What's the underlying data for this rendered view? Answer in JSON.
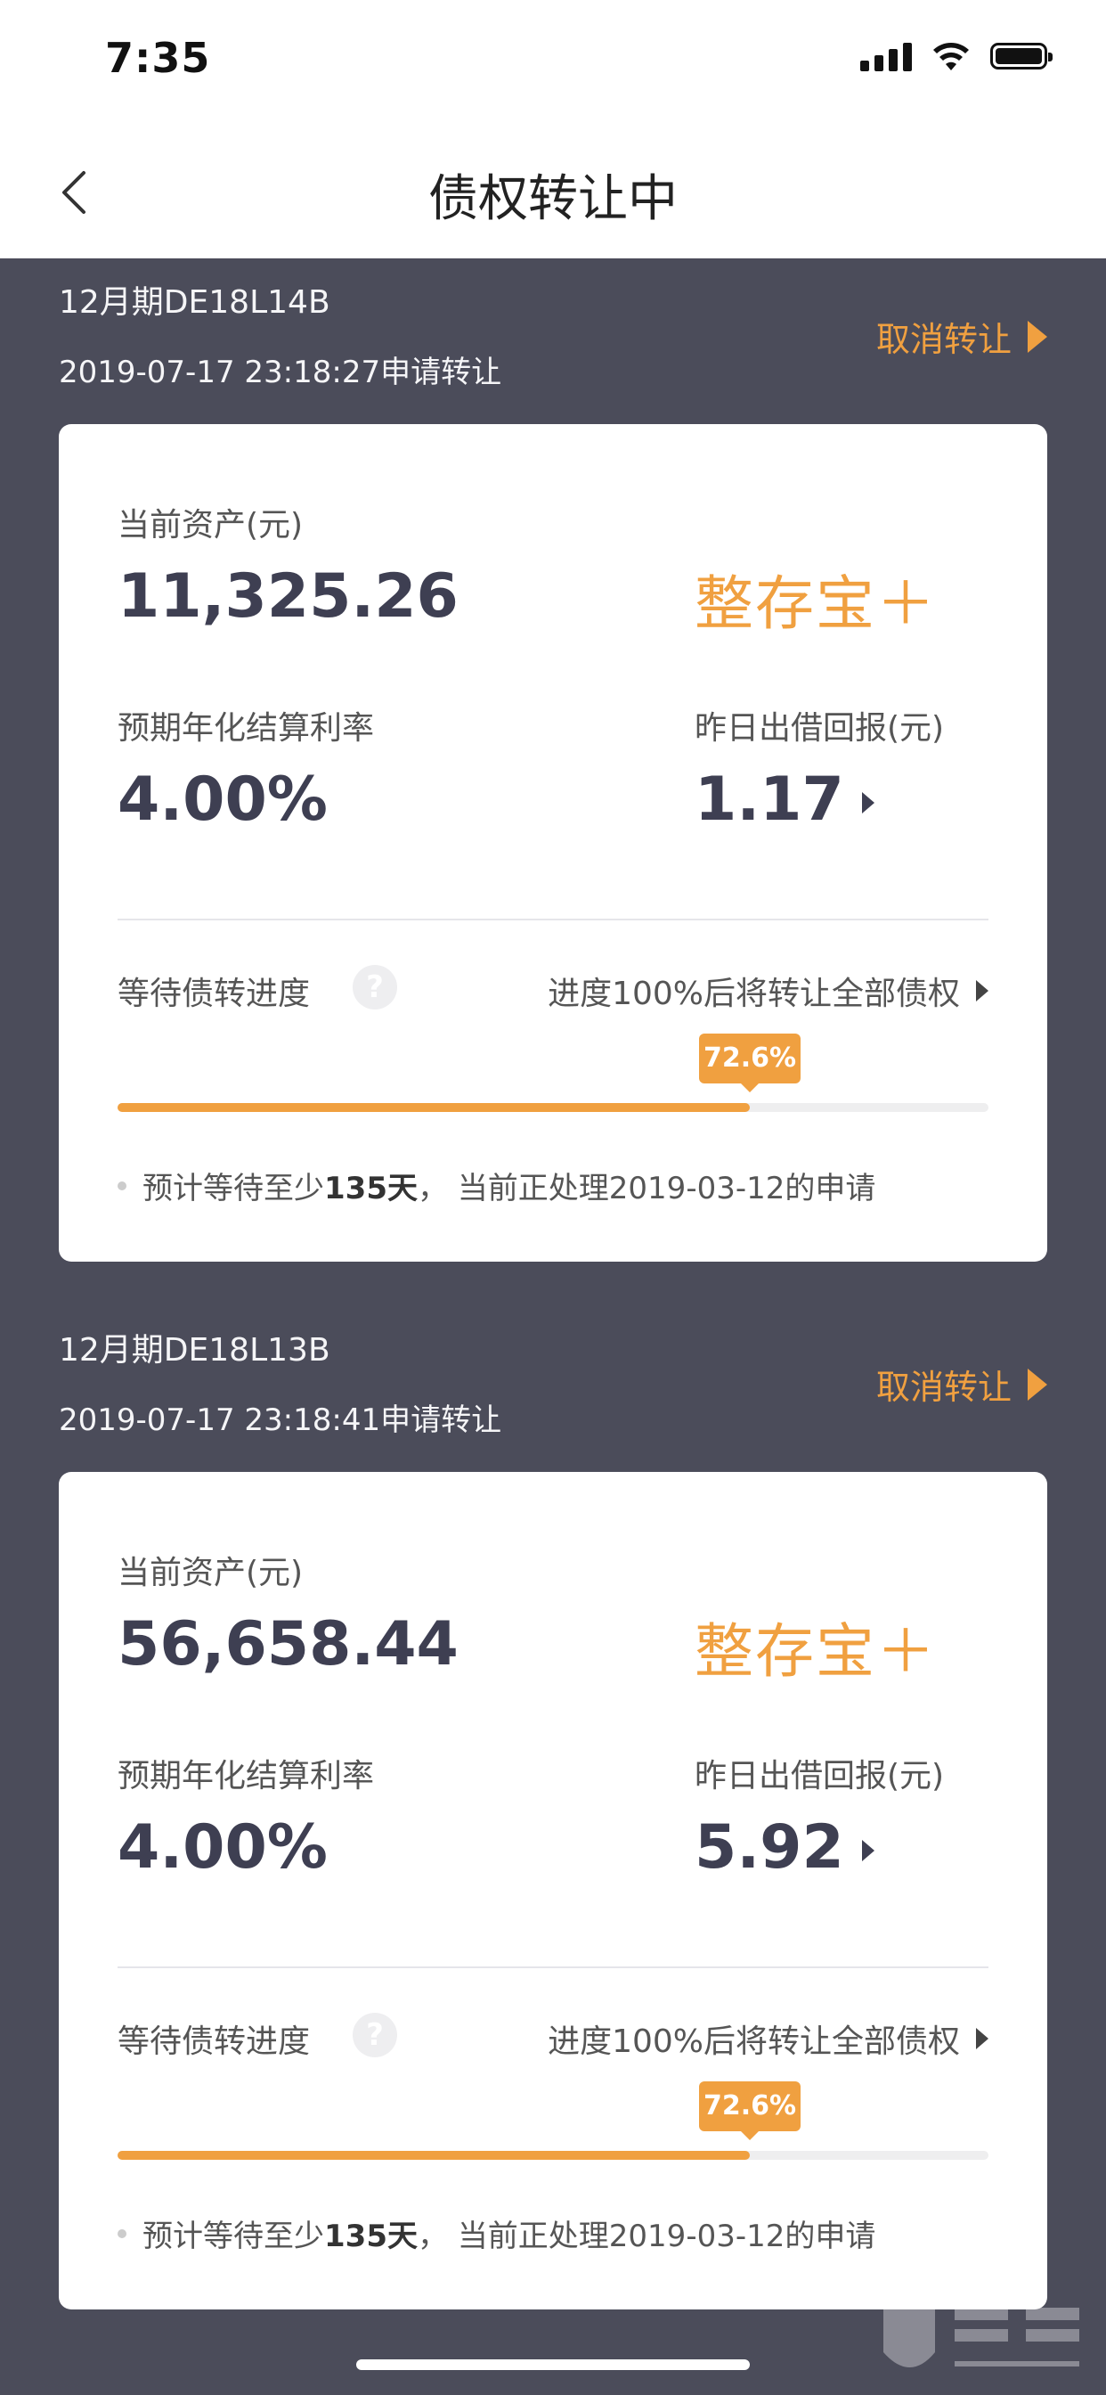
{
  "status_bar": {
    "time": "7:35"
  },
  "nav": {
    "title": "债权转让中"
  },
  "labels": {
    "current_assets": "当前资产(元)",
    "expected_rate": "预期年化结算利率",
    "yesterday_return": "昨日出借回报(元)",
    "progress_label": "等待债转进度",
    "progress_rule": "进度100%后将转让全部债权",
    "note_prefix": "预计等待至少",
    "note_suffix": "， 当前正处理2019-03-12的申请",
    "cancel": "取消转让",
    "help_glyph": "?"
  },
  "transfers": [
    {
      "code": "12月期DE18L14B",
      "applied_at": "2019-07-17 23:18:27申请转让",
      "assets": "11,325.26",
      "product": "整存宝＋",
      "rate": "4.00%",
      "yesterday": "1.17",
      "progress_text": "72.6%",
      "progress": 0.726,
      "wait_days": "135天"
    },
    {
      "code": "12月期DE18L13B",
      "applied_at": "2019-07-17 23:18:41申请转让",
      "assets": "56,658.44",
      "product": "整存宝＋",
      "rate": "4.00%",
      "yesterday": "5.92",
      "progress_text": "72.6%",
      "progress": 0.726,
      "wait_days": "135天"
    }
  ],
  "colors": {
    "accent": "#f0a040",
    "background": "#4b4c5a",
    "value_text": "#3e3f52"
  }
}
